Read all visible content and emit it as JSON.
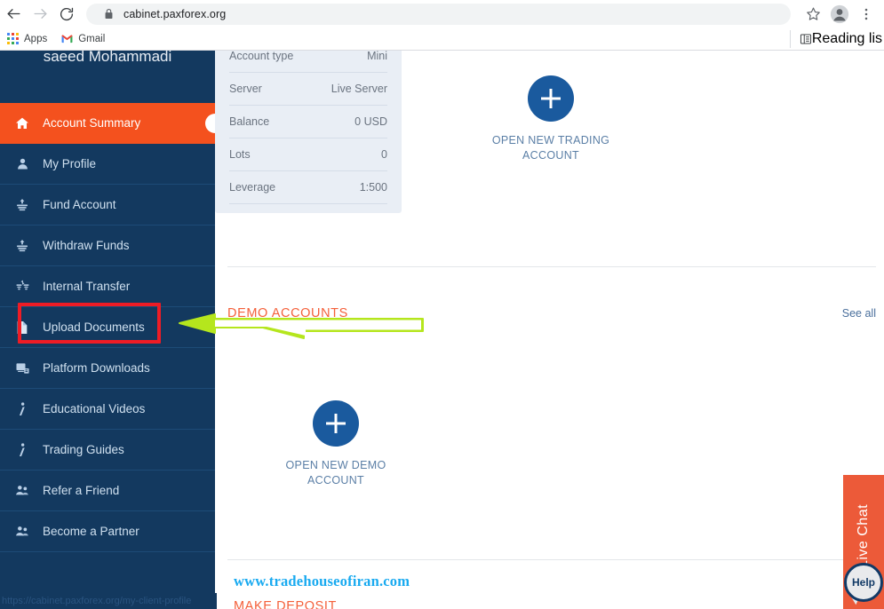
{
  "browser": {
    "url": "cabinet.paxforex.org",
    "back_icon": "back-arrow-icon",
    "forward_icon": "forward-arrow-icon",
    "reload_icon": "reload-icon",
    "lock_icon": "lock-icon",
    "star_icon": "star-icon",
    "profile_icon": "profile-avatar-icon",
    "menu_icon": "three-dot-menu-icon",
    "bookmarks": [
      {
        "label": "Apps",
        "icon": "apps-grid-icon"
      },
      {
        "label": "Gmail",
        "icon": "gmail-icon"
      }
    ],
    "reading_list": "Reading lis",
    "status_url": "https://cabinet.paxforex.org/my-client-profile"
  },
  "sidebar": {
    "user_name": "saeed Mohammadi",
    "items": [
      {
        "label": "Account Summary",
        "icon": "home-icon",
        "active": true
      },
      {
        "label": "My Profile",
        "icon": "person-icon",
        "active": false
      },
      {
        "label": "Fund Account",
        "icon": "deposit-funds-icon",
        "active": false
      },
      {
        "label": "Withdraw Funds",
        "icon": "withdraw-funds-icon",
        "active": false
      },
      {
        "label": "Internal Transfer",
        "icon": "transfer-icon",
        "active": false
      },
      {
        "label": "Upload Documents",
        "icon": "document-icon",
        "active": false
      },
      {
        "label": "Platform Downloads",
        "icon": "monitor-download-icon",
        "active": false
      },
      {
        "label": "Educational Videos",
        "icon": "info-icon",
        "active": false
      },
      {
        "label": "Trading Guides",
        "icon": "info-icon",
        "active": false
      },
      {
        "label": "Refer a Friend",
        "icon": "people-icon",
        "active": false
      },
      {
        "label": "Become a Partner",
        "icon": "people-icon",
        "active": false
      }
    ]
  },
  "main": {
    "account_card": {
      "rows": [
        {
          "key": "Account type",
          "value": "Mini"
        },
        {
          "key": "Server",
          "value": "Live Server"
        },
        {
          "key": "Balance",
          "value": "0 USD"
        },
        {
          "key": "Lots",
          "value": "0"
        },
        {
          "key": "Leverage",
          "value": "1:500"
        }
      ]
    },
    "open_trading_account": {
      "icon": "plus-icon",
      "line1": "OPEN NEW TRADING",
      "line2": "ACCOUNT"
    },
    "demo_section": {
      "title": "DEMO ACCOUNTS",
      "see_all": "See all",
      "open_demo": {
        "icon": "plus-icon",
        "line1": "OPEN NEW DEMO",
        "line2": "ACCOUNT"
      }
    },
    "watermark": "www.tradehouseofiran.com",
    "make_deposit": "MAKE DEPOSIT"
  },
  "live_chat": {
    "label": "Live Chat",
    "help_label": "Help",
    "color": "#ec5a39"
  },
  "annotations": {
    "highlight_box_target": "Upload Documents",
    "highlight_box_color": "#ee1c25",
    "arrow_color": "#b5e61d"
  },
  "colors": {
    "sidebar_bg": "#13395f",
    "active_item": "#f4511e",
    "accent_blue": "#1a5a9e",
    "section_orange": "#f4603a",
    "watermark_blue": "#19aaf0"
  }
}
